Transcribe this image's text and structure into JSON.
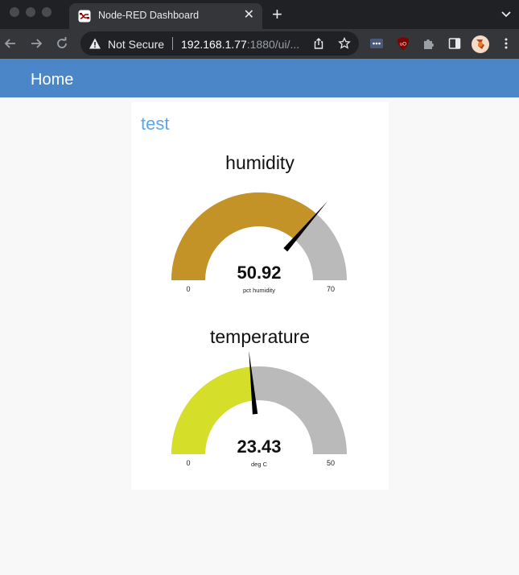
{
  "browser": {
    "tab_title": "Node-RED Dashboard",
    "security_label": "Not Secure",
    "url_host": "192.168.1.77",
    "url_rest": ":1880/ui/..."
  },
  "app": {
    "title": "Home"
  },
  "group": {
    "title": "test"
  },
  "gauges": [
    {
      "title": "humidity",
      "value": "50.92",
      "units": "pct humidity",
      "min": "0",
      "max": "70",
      "color": "#c49328"
    },
    {
      "title": "temperature",
      "value": "23.43",
      "units": "deg C",
      "min": "0",
      "max": "50",
      "color": "#d5df2a"
    }
  ],
  "colors": {
    "header": "#4a86c8",
    "group_title": "#5aa8e6",
    "track": "#bababa"
  },
  "icons": [
    "node-red-favicon",
    "close-icon",
    "new-tab-icon",
    "tab-menu-icon",
    "back-icon",
    "forward-icon",
    "reload-icon",
    "warning-icon",
    "share-icon",
    "bookmark-star-icon",
    "extension-dots-icon",
    "ublock-icon",
    "puzzle-icon",
    "side-panel-icon",
    "profile-avatar-icon",
    "kebab-menu-icon"
  ]
}
